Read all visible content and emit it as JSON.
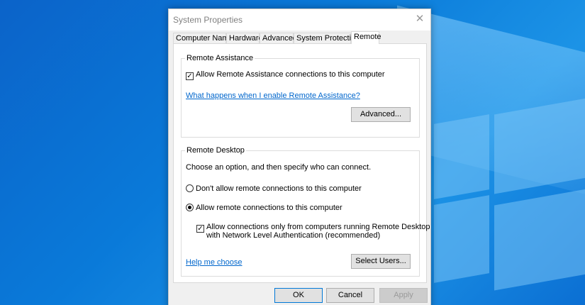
{
  "window": {
    "title": "System Properties",
    "close_glyph": "✕"
  },
  "tabs": [
    {
      "label": "Computer Name"
    },
    {
      "label": "Hardware"
    },
    {
      "label": "Advanced"
    },
    {
      "label": "System Protection"
    },
    {
      "label": "Remote",
      "active": true
    }
  ],
  "remote_assistance": {
    "group_title": "Remote Assistance",
    "allow_checkbox_label": "Allow Remote Assistance connections to this computer",
    "allow_checked": true,
    "help_link": "What happens when I enable Remote Assistance?",
    "advanced_button": "Advanced..."
  },
  "remote_desktop": {
    "group_title": "Remote Desktop",
    "instruction": "Choose an option, and then specify who can connect.",
    "option_dont_allow": "Don't allow remote connections to this computer",
    "option_allow": "Allow remote connections to this computer",
    "selected_option": "allow",
    "nla_checkbox_line1": "Allow connections only from computers running Remote Desktop",
    "nla_checkbox_line2": "with Network Level Authentication (recommended)",
    "nla_checked": true,
    "help_link": "Help me choose",
    "select_users_button": "Select Users..."
  },
  "footer": {
    "ok": "OK",
    "cancel": "Cancel",
    "apply": "Apply",
    "apply_disabled": true
  },
  "icons": {
    "check": "✓"
  }
}
